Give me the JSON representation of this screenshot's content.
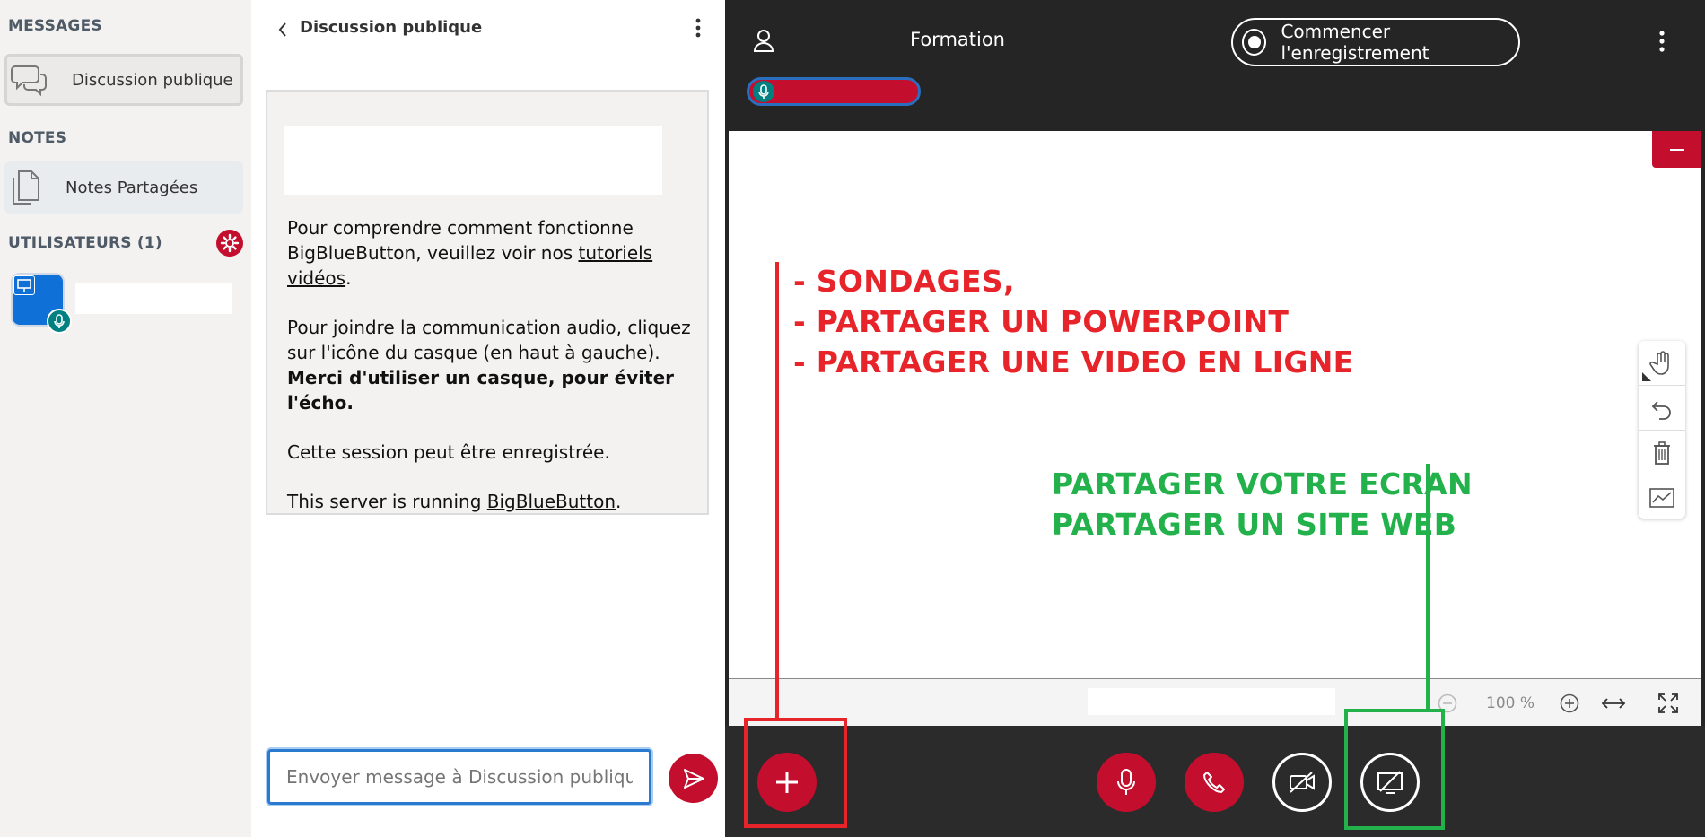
{
  "userlist": {
    "messages_title": "MESSAGES",
    "public_chat_label": "Discussion publique",
    "notes_title": "NOTES",
    "shared_notes_label": "Notes Partagées",
    "users_title": "UTILISATEURS (1)"
  },
  "chat": {
    "header_title": "Discussion publique",
    "welcome": {
      "p1_pre": "Pour comprendre comment fonctionne BigBlueButton, veuillez voir nos ",
      "p1_link": "tutoriels vidéos",
      "p1_post": ".",
      "p2_pre": "Pour joindre la communication audio, cliquez sur l'icône du casque (en haut à gauche). ",
      "p2_bold": "Merci d'utiliser un casque, pour éviter l'écho.",
      "p3": "Cette session peut être enregistrée.",
      "p4_pre": "This server is running ",
      "p4_link": "BigBlueButton",
      "p4_post": "."
    },
    "input_placeholder": "Envoyer message à Discussion publique"
  },
  "main": {
    "title": "Formation",
    "record_label": "Commencer l'enregistrement",
    "zoom_level": "100 %"
  },
  "annotations": {
    "red_lines": [
      "- SONDAGES,",
      "- PARTAGER UN POWERPOINT",
      "- PARTAGER UNE VIDEO EN LIGNE"
    ],
    "green_lines": [
      "PARTAGER VOTRE ECRAN",
      "PARTAGER UN SITE WEB"
    ]
  },
  "colors": {
    "accent_red": "#c40e2e",
    "annotation_red": "#e8242b",
    "annotation_green": "#23b14b",
    "focus_blue": "#2a7bd0"
  },
  "icons": [
    "chat-bubbles-icon",
    "notes-icon",
    "gear-icon",
    "presenter-icon",
    "mic-icon",
    "chevron-left-icon",
    "kebab-icon",
    "send-icon",
    "user-icon",
    "record-icon",
    "minimize-icon",
    "hand-icon",
    "undo-icon",
    "trash-icon",
    "multi-user-icon",
    "zoom-out-icon",
    "zoom-in-icon",
    "fit-width-icon",
    "fullscreen-icon",
    "plus-icon",
    "phone-icon",
    "camera-off-icon",
    "screenshare-off-icon"
  ]
}
